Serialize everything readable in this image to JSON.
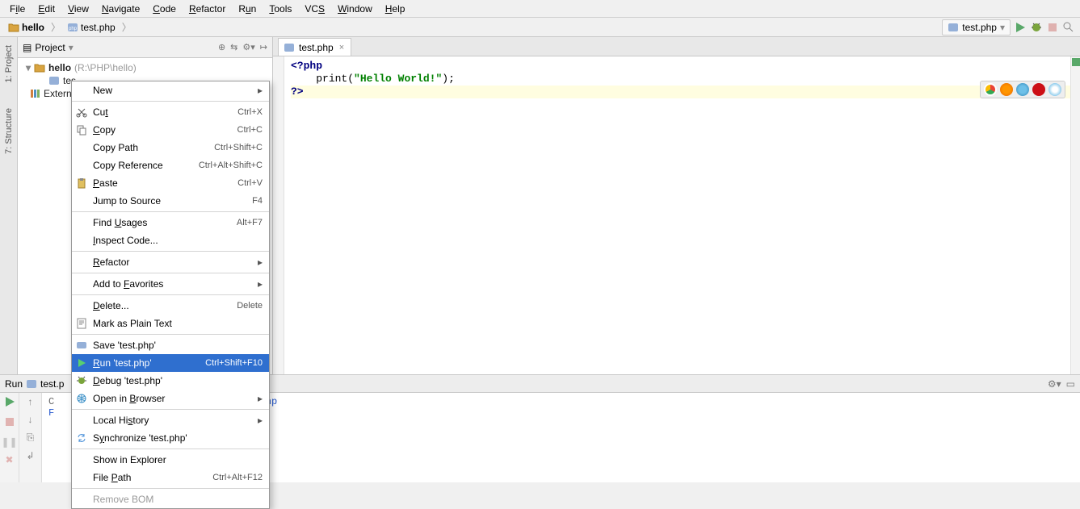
{
  "menubar": [
    "File",
    "Edit",
    "View",
    "Navigate",
    "Code",
    "Refactor",
    "Run",
    "Tools",
    "VCS",
    "Window",
    "Help"
  ],
  "breadcrumbs": {
    "root": "hello",
    "file": "test.php"
  },
  "run_config": {
    "label": "test.php"
  },
  "project_panel": {
    "title": "Project",
    "root": {
      "name": "hello",
      "path": "(R:\\PHP\\hello)"
    },
    "file": "test.php",
    "external": "External Libraries"
  },
  "tab": {
    "label": "test.php"
  },
  "code": {
    "l1_open": "<?php",
    "l2_indent": "    ",
    "l2_fn": "print",
    "l2_open": "(",
    "l2_str": "\"Hello World!\"",
    "l2_close": ");",
    "l3_close": "?>"
  },
  "context_menu": [
    {
      "label": "New",
      "shortcut": "",
      "submenu": true
    },
    {
      "sep": true
    },
    {
      "icon": "cut",
      "label": "Cut",
      "shortcut": "Ctrl+X",
      "u": 2
    },
    {
      "icon": "copy",
      "label": "Copy",
      "shortcut": "Ctrl+C",
      "u": 0
    },
    {
      "label": "Copy Path",
      "shortcut": "Ctrl+Shift+C"
    },
    {
      "label": "Copy Reference",
      "shortcut": "Ctrl+Alt+Shift+C"
    },
    {
      "icon": "paste",
      "label": "Paste",
      "shortcut": "Ctrl+V",
      "u": 0
    },
    {
      "label": "Jump to Source",
      "shortcut": "F4"
    },
    {
      "sep": true
    },
    {
      "label": "Find Usages",
      "shortcut": "Alt+F7",
      "u": 5
    },
    {
      "label": "Inspect Code...",
      "u": 0
    },
    {
      "sep": true
    },
    {
      "label": "Refactor",
      "submenu": true,
      "u": 0
    },
    {
      "sep": true
    },
    {
      "label": "Add to Favorites",
      "submenu": true,
      "u": 7
    },
    {
      "sep": true
    },
    {
      "label": "Delete...",
      "shortcut": "Delete",
      "u": 0
    },
    {
      "icon": "text",
      "label": "Mark as Plain Text"
    },
    {
      "sep": true
    },
    {
      "icon": "php",
      "label": "Save 'test.php'"
    },
    {
      "icon": "run",
      "label": "Run 'test.php'",
      "shortcut": "Ctrl+Shift+F10",
      "selected": true,
      "u": 0
    },
    {
      "icon": "debug",
      "label": "Debug 'test.php'",
      "u": 0
    },
    {
      "icon": "browser",
      "label": "Open in Browser",
      "submenu": true,
      "u": 8
    },
    {
      "sep": true
    },
    {
      "label": "Local History",
      "submenu": true,
      "u": 8
    },
    {
      "icon": "sync",
      "label": "Synchronize 'test.php'",
      "u": 1
    },
    {
      "sep": true
    },
    {
      "label": "Show in Explorer"
    },
    {
      "label": "File Path",
      "shortcut": "Ctrl+Alt+F12",
      "u": 5
    },
    {
      "sep": true
    },
    {
      "label": "Remove BOM",
      "disabled": true
    }
  ],
  "run_panel": {
    "title": "Run",
    "config": "test.php",
    "output_fragment": "st.php"
  },
  "sidebar_tabs": {
    "project": "1: Project",
    "structure": "7: Structure"
  }
}
